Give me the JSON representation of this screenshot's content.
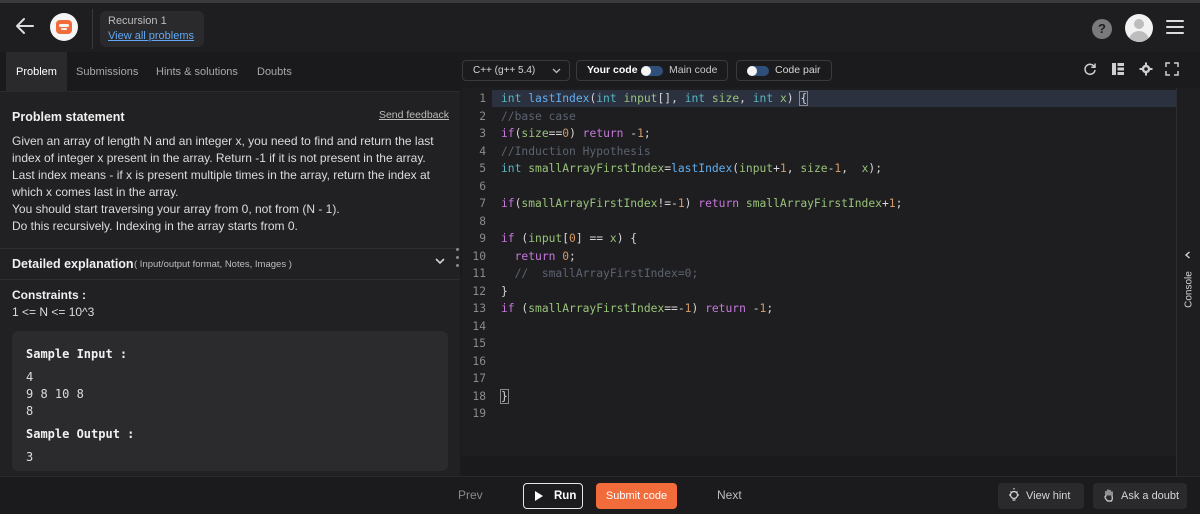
{
  "header": {
    "back_icon": "arrow-left-icon",
    "breadcrumb_title": "Recursion 1",
    "breadcrumb_link": "View all problems",
    "help_label": "?"
  },
  "tabs": [
    {
      "label": "Problem",
      "active": true
    },
    {
      "label": "Submissions",
      "active": false
    },
    {
      "label": "Hints & solutions",
      "active": false
    },
    {
      "label": "Doubts",
      "active": false
    }
  ],
  "problem": {
    "title": "Problem statement",
    "feedback": "Send feedback",
    "paragraphs": [
      "Given an array of length N and an integer x, you need to find and return the last index of integer x present in the array. Return -1 if it is not present in the array.",
      "Last index means - if x is present multiple times in the array, return the index at which x comes last in the array.",
      "You should start traversing your array from 0, not from (N - 1).",
      "Do this recursively. Indexing in the array starts from 0."
    ],
    "detail_title": "Detailed explanation",
    "detail_note": "( Input/output format, Notes, Images )",
    "constraints_title": "Constraints :",
    "constraints_value": "1 <= N <= 10^3",
    "sample_input_label": "Sample Input :",
    "sample_input_lines": [
      "4",
      "9 8 10 8",
      "8"
    ],
    "sample_output_label": "Sample Output :",
    "sample_output_lines": [
      "3"
    ]
  },
  "editor": {
    "language": "C++ (g++ 5.4)",
    "your_code": "Your code",
    "main_code": "Main code",
    "code_pair": "Code pair",
    "line_numbers": [
      "1",
      "2",
      "3",
      "4",
      "5",
      "6",
      "7",
      "8",
      "9",
      "10",
      "11",
      "12",
      "13",
      "14",
      "15",
      "16",
      "17",
      "18",
      "19"
    ],
    "console_label": "Console"
  },
  "footer": {
    "prev": "Prev",
    "run": "Run",
    "submit": "Submit code",
    "next": "Next",
    "view_hint": "View hint",
    "ask_doubt": "Ask a doubt"
  },
  "colors": {
    "accent": "#f26b3a",
    "link": "#62a8f5",
    "background": "#1b1b1d"
  }
}
